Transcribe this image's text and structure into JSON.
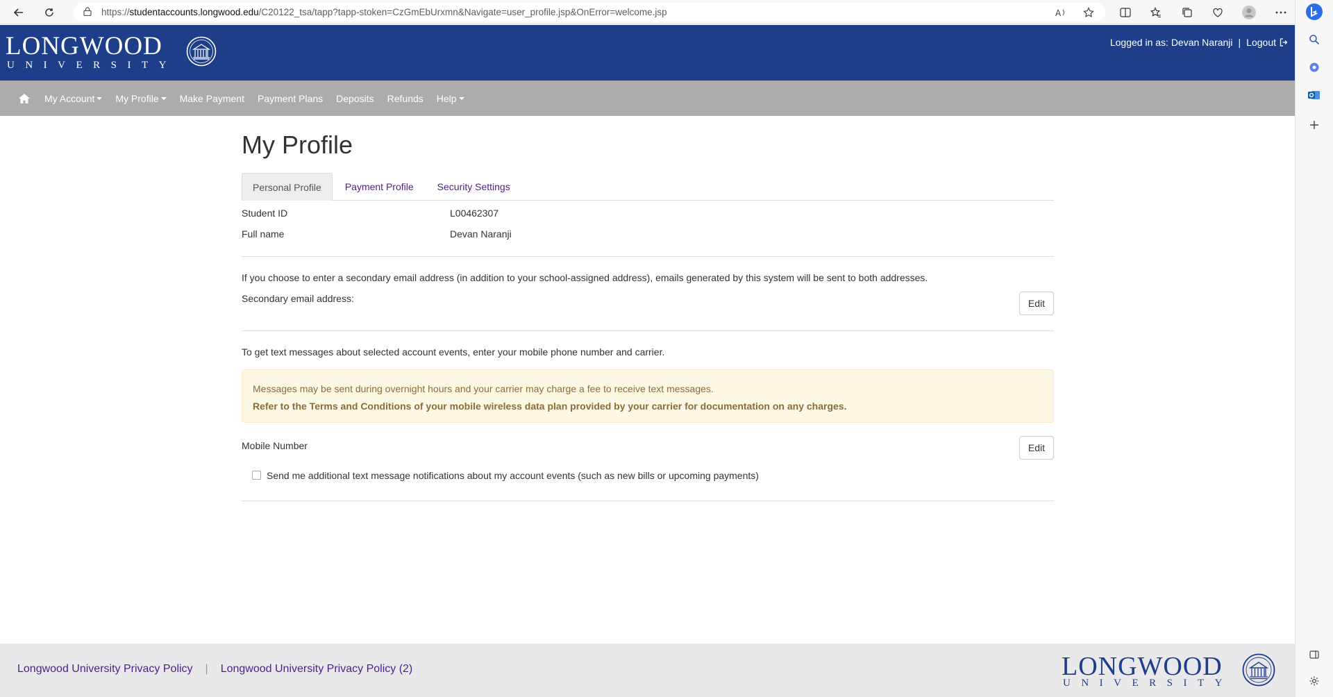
{
  "browser": {
    "url_prefix": "https://",
    "url_host": "studentaccounts.longwood.edu",
    "url_path": "/C20122_tsa/tapp?tapp-stoken=CzGmEbUrxmn&Navigate=user_profile.jsp&OnError=welcome.jsp"
  },
  "header": {
    "logo_word": "LONGWOOD",
    "logo_sub": "UNIVERSITY",
    "logged_in_label": "Logged in as: Devan Naranji",
    "separator": "|",
    "logout_label": "Logout"
  },
  "menu": {
    "items": [
      {
        "label": "My Account",
        "dropdown": true
      },
      {
        "label": "My Profile",
        "dropdown": true
      },
      {
        "label": "Make Payment",
        "dropdown": false
      },
      {
        "label": "Payment Plans",
        "dropdown": false
      },
      {
        "label": "Deposits",
        "dropdown": false
      },
      {
        "label": "Refunds",
        "dropdown": false
      },
      {
        "label": "Help",
        "dropdown": true
      }
    ]
  },
  "page": {
    "title": "My Profile",
    "tabs": [
      {
        "label": "Personal Profile",
        "active": true
      },
      {
        "label": "Payment Profile",
        "active": false
      },
      {
        "label": "Security Settings",
        "active": false
      }
    ],
    "student_id_label": "Student ID",
    "student_id_value": "L00462307",
    "full_name_label": "Full name",
    "full_name_value": "Devan Naranji",
    "secondary_email_info": "If you choose to enter a secondary email address (in addition to your school-assigned address), emails generated by this system will be sent to both addresses.",
    "secondary_email_label": "Secondary email address:",
    "edit_label": "Edit",
    "text_info": "To get text messages about selected account events, enter your mobile phone number and carrier.",
    "alert_line1": "Messages may be sent during overnight hours and your carrier may charge a fee to receive text messages.",
    "alert_line2": "Refer to the Terms and Conditions of your mobile wireless data plan provided by your carrier for documentation on any charges.",
    "mobile_label": "Mobile Number",
    "checkbox_label": "Send me additional text message notifications about my account events (such as new bills or upcoming payments)"
  },
  "footer": {
    "link1": "Longwood University Privacy Policy",
    "separator": "|",
    "link2": "Longwood University Privacy Policy (2)",
    "logo_word": "LONGWOOD",
    "logo_sub": "UNIVERSITY"
  },
  "colors": {
    "brand_blue": "#1f3e8a",
    "menu_gray": "#acacac",
    "alert_bg": "#fcf8e3",
    "link_purple": "#551a8b"
  }
}
